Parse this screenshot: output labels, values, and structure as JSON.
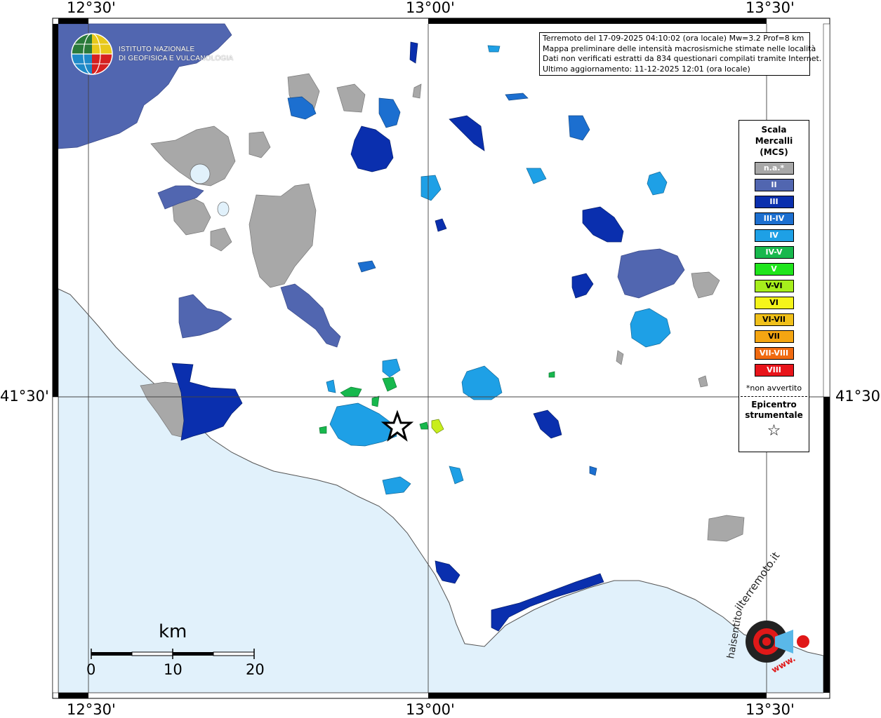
{
  "coords": {
    "top_left": "12°30'",
    "top_mid": "13°00'",
    "top_right": "13°30'",
    "bottom_left": "12°30'",
    "bottom_mid": "13°00'",
    "bottom_right": "13°30'",
    "left_lat": "41°30'",
    "right_lat": "41°30'"
  },
  "info": {
    "line1": "Terremoto del 17-09-2025 04:10:02 (ora locale) Mw=3.2 Prof=8 km",
    "line2": "Mappa preliminare delle intensità macrosismiche stimate nelle località",
    "line3": "Dati non verificati estratti da 834 questionari compilati tramite Internet.",
    "line4": "Ultimo aggiornamento: 11-12-2025 12:01 (ora locale)"
  },
  "logo": {
    "line1": "ISTITUTO NAZIONALE",
    "line2": "DI GEOFISICA E VULCANOLOGIA"
  },
  "legend": {
    "title1": "Scala",
    "title2": "Mercalli",
    "title3": "(MCS)",
    "items": [
      {
        "label": "n.a.*",
        "color": "#a8a8a8"
      },
      {
        "label": "II",
        "color": "#5166b0"
      },
      {
        "label": "III",
        "color": "#0a2fae"
      },
      {
        "label": "III-IV",
        "color": "#1c6fd0"
      },
      {
        "label": "IV",
        "color": "#1ea0e6"
      },
      {
        "label": "IV-V",
        "color": "#17b84d"
      },
      {
        "label": "V",
        "color": "#1fe51c"
      },
      {
        "label": "V-VI",
        "color": "#a6ee1c"
      },
      {
        "label": "VI",
        "color": "#f5f51a"
      },
      {
        "label": "VI-VII",
        "color": "#f0c01a"
      },
      {
        "label": "VII",
        "color": "#f4a512"
      },
      {
        "label": "VII-VIII",
        "color": "#f06a10"
      },
      {
        "label": "VIII",
        "color": "#e8141a"
      }
    ],
    "note": "*non avvertito",
    "epi1": "Epicentro",
    "epi2": "strumentale",
    "star": "☆"
  },
  "scale": {
    "unit": "km",
    "tick0": "0",
    "tick10": "10",
    "tick20": "20"
  },
  "watermark": {
    "text1": "haisentito",
    "text2": "ilterremoto.it",
    "text3": "www."
  },
  "colors": {
    "sea": "#e1f1fb",
    "land": "#ffffff",
    "na": "#a8a8a8",
    "II": "#5166b0",
    "III": "#0a2fae",
    "IIIIV": "#1c6fd0",
    "IV": "#1ea0e6",
    "IVV": "#17b84d"
  }
}
